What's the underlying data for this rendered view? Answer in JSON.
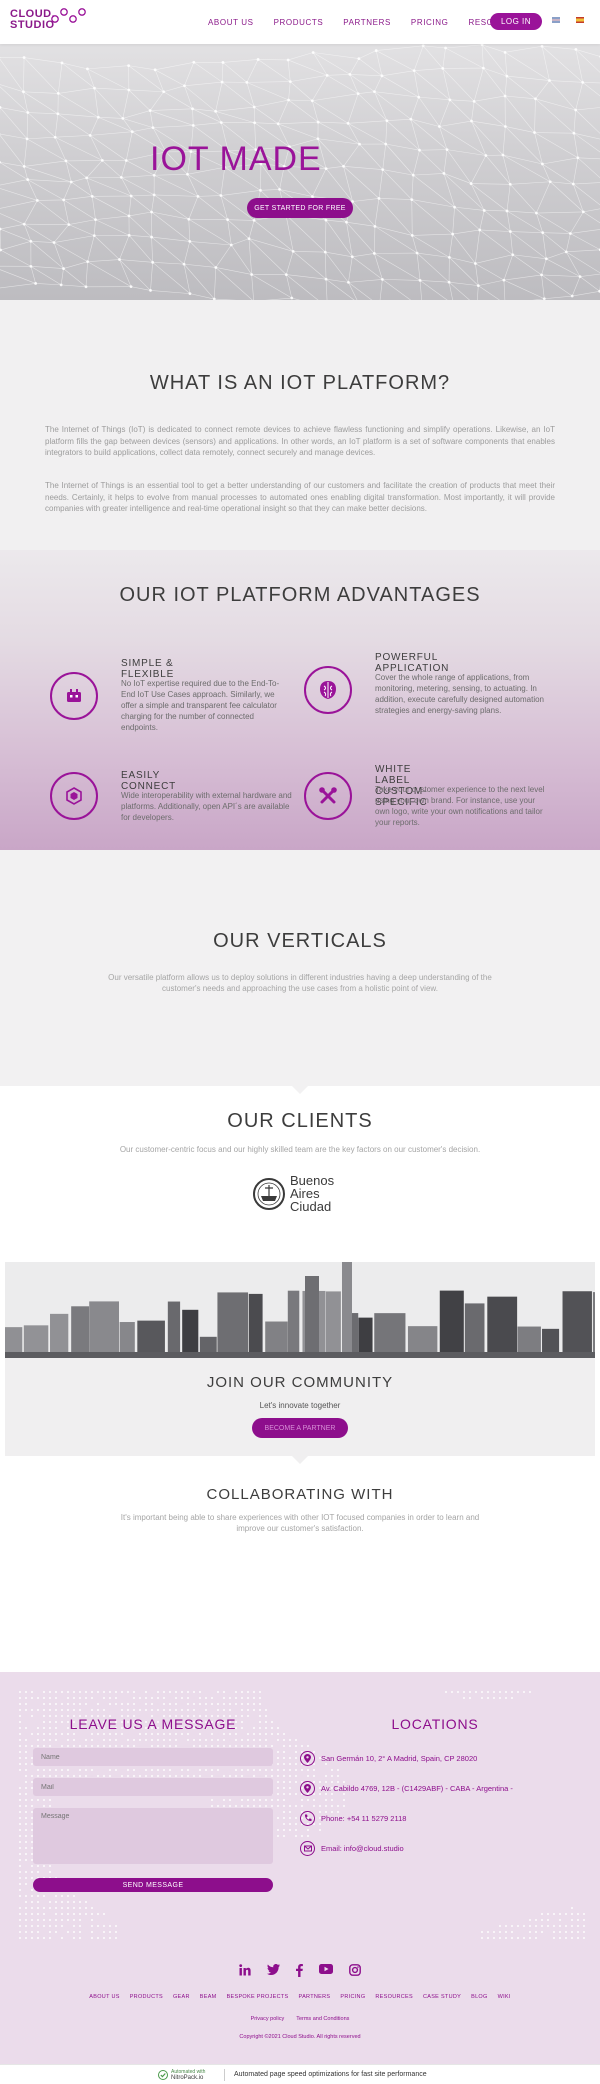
{
  "header": {
    "logo_line1": "CLOUD.",
    "logo_line2": "STUDIO",
    "nav": [
      "ABOUT US",
      "PRODUCTS",
      "PARTNERS",
      "PRICING",
      "RESOURCES"
    ],
    "login_label": "LOG IN",
    "flags": [
      "english-flag-icon",
      "spanish-flag-icon"
    ]
  },
  "hero": {
    "title": "IOT MADE",
    "cta_label": "GET STARTED FOR FREE"
  },
  "what": {
    "title": "WHAT IS AN IOT PLATFORM?",
    "paragraph1": "The Internet of Things (IoT) is dedicated to connect remote devices to achieve flawless functioning and simplify operations. Likewise, an IoT platform fills the gap between devices (sensors) and applications. In other words, an IoT platform is a set of software components that enables integrators to build applications, collect data remotely, connect securely and manage devices.",
    "paragraph2": "The Internet of Things is an essential tool to get a better understanding of our customers and facilitate the creation of products that meet their needs. Certainly, it helps to evolve from manual processes to automated ones enabling digital transformation. Most importantly, it will provide companies with greater intelligence and real-time operational insight so that they can make better decisions."
  },
  "advantages": {
    "title": "OUR IOT PLATFORM ADVANTAGES",
    "items": [
      {
        "heading": "SIMPLE & FLEXIBLE",
        "text": "No IoT expertise required due to the End-To-End IoT Use Cases approach. Similarly, we offer a simple and transparent fee calculator charging for the number of connected endpoints.",
        "icon": "device-icon"
      },
      {
        "heading": "POWERFUL APPLICATION",
        "text": "Cover the whole range of applications, from monitoring, metering, sensing, to actuating. In addition, execute carefully designed automation strategies and energy-saving plans.",
        "icon": "brain-icon"
      },
      {
        "heading": "EASILY CONNECT",
        "text": "Wide interoperability with external hardware and platforms. Additionally, open API´s are available for developers.",
        "icon": "hexagon-icon"
      },
      {
        "heading": "WHITE LABEL CUSTOM-SPECIFIC",
        "text": "Take your customer experience to the next level using your own brand. For instance, use your own logo, write your own notifications and tailor your reports.",
        "icon": "tools-icon"
      }
    ]
  },
  "verticals": {
    "title": "OUR VERTICALS",
    "text": "Our versatile platform allows us to deploy solutions in different industries having a deep understanding of the customer's needs and approaching the use cases from a holistic point of view."
  },
  "clients": {
    "title": "OUR CLIENTS",
    "text": "Our customer-centric focus and our highly skilled team are the key factors on our customer's decision.",
    "client_logo_text": [
      "Buenos",
      "Aires",
      "Ciudad"
    ]
  },
  "community": {
    "title": "JOIN OUR COMMUNITY",
    "subtitle": "Let's innovate together",
    "cta_label": "BECOME A PARTNER"
  },
  "collab": {
    "title": "COLLABORATING WITH",
    "text": "It's important being able to share experiences with other IOT focused companies in order to learn and improve our customer's satisfaction."
  },
  "footer": {
    "form_title": "LEAVE US A MESSAGE",
    "name_placeholder": "Name",
    "mail_placeholder": "Mail",
    "message_placeholder": "Message",
    "send_label": "SEND MESSAGE",
    "locations_title": "LOCATIONS",
    "locations": [
      {
        "text": "San Germán 10, 2° A Madrid, Spain, CP 28020",
        "icon": "location-pin-icon"
      },
      {
        "text": "Av. Cabildo 4769, 12B - (C1429ABF) - CABA - Argentina -",
        "icon": "location-pin-icon"
      },
      {
        "text": "Phone: +54 11 5279 2118",
        "icon": "phone-icon"
      },
      {
        "text": "Email: info@cloud.studio",
        "icon": "email-icon"
      }
    ],
    "social": [
      "linkedin-icon",
      "twitter-icon",
      "facebook-icon",
      "youtube-icon",
      "instagram-icon"
    ],
    "links": [
      "ABOUT US",
      "PRODUCTS",
      "GEAR",
      "BEAM",
      "BESPOKE PROJECTS",
      "PARTNERS",
      "PRICING",
      "RESOURCES",
      "CASE STUDY",
      "BLOG",
      "WIKI"
    ],
    "sub_links": [
      "Privacy policy",
      "Terms and Conditions"
    ],
    "copyright": "Copyright ©2021 Cloud Studio. All rights reserved"
  },
  "bottom_bar": {
    "badge_line1": "Automated with",
    "badge_line2": "NitroPack.io",
    "message": "Automated page speed optimizations for fast site performance"
  },
  "colors": {
    "brand_purple": "#9a1399",
    "footer_bg": "#ebdceb"
  }
}
